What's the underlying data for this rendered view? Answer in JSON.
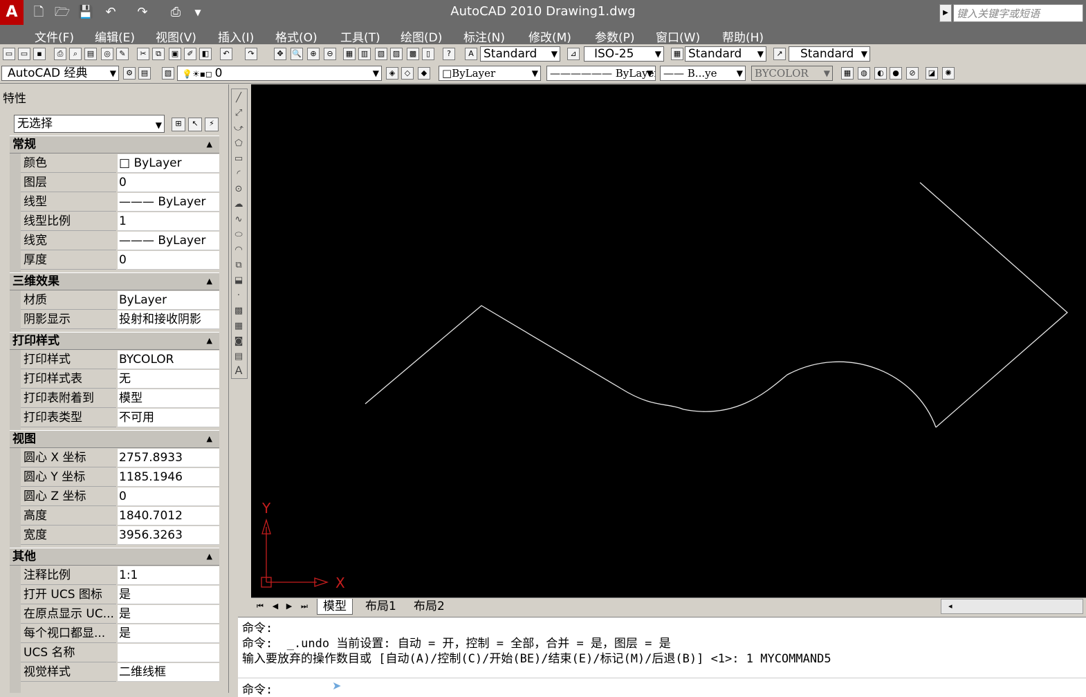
{
  "titlebar": {
    "title": "AutoCAD 2010    Drawing1.dwg",
    "logo_letter": "A",
    "quick_access": [
      "file-new-icon",
      "open-icon",
      "save-icon",
      "undo-icon",
      "redo-icon",
      "plot-icon",
      "dropdown-icon"
    ],
    "search_placeholder": "键入关键字或短语"
  },
  "menubar": {
    "items": [
      "文件(F)",
      "编辑(E)",
      "视图(V)",
      "插入(I)",
      "格式(O)",
      "工具(T)",
      "绘图(D)",
      "标注(N)",
      "修改(M)",
      "参数(P)",
      "窗口(W)",
      "帮助(H)"
    ]
  },
  "toolbar1": {
    "text_style": "Standard",
    "dim_style": "ISO-25",
    "table_style": "Standard",
    "mleader_style": "Standard"
  },
  "toolbar2": {
    "workspace": "AutoCAD 经典",
    "layer": "0",
    "color": "ByLayer",
    "linetype": "ByLayer",
    "lineweight": "B...ye",
    "plotstyle": "BYCOLOR"
  },
  "properties": {
    "title": "特性",
    "selection": "无选择",
    "sections": [
      {
        "name": "常规",
        "rows": [
          [
            "颜色",
            "□ ByLayer"
          ],
          [
            "图层",
            "0"
          ],
          [
            "线型",
            "——— ByLayer"
          ],
          [
            "线型比例",
            "1"
          ],
          [
            "线宽",
            "——— ByLayer"
          ],
          [
            "厚度",
            "0"
          ]
        ]
      },
      {
        "name": "三维效果",
        "rows": [
          [
            "材质",
            "ByLayer"
          ],
          [
            "阴影显示",
            "投射和接收阴影"
          ]
        ]
      },
      {
        "name": "打印样式",
        "rows": [
          [
            "打印样式",
            "BYCOLOR"
          ],
          [
            "打印样式表",
            "无"
          ],
          [
            "打印表附着到",
            "模型"
          ],
          [
            "打印表类型",
            "不可用"
          ]
        ]
      },
      {
        "name": "视图",
        "rows": [
          [
            "圆心 X 坐标",
            "2757.8933"
          ],
          [
            "圆心 Y 坐标",
            "1185.1946"
          ],
          [
            "圆心 Z 坐标",
            "0"
          ],
          [
            "高度",
            "1840.7012"
          ],
          [
            "宽度",
            "3956.3263"
          ]
        ]
      },
      {
        "name": "其他",
        "rows": [
          [
            "注释比例",
            "1:1"
          ],
          [
            "打开 UCS 图标",
            "是"
          ],
          [
            "在原点显示 UC...",
            "是"
          ],
          [
            "每个视口都显...",
            "是"
          ],
          [
            "UCS 名称",
            ""
          ],
          [
            "视觉样式",
            "二维线框"
          ]
        ]
      }
    ]
  },
  "canvas": {
    "ucs_y": "Y",
    "ucs_x": "X"
  },
  "tabs": {
    "items": [
      "模型",
      "布局1",
      "布局2"
    ],
    "active": 0
  },
  "command": {
    "lines": [
      "命令:",
      "命令:  _.undo 当前设置: 自动 = 开，控制 = 全部，合并 = 是，图层 = 是",
      "输入要放弃的操作数目或 [自动(A)/控制(C)/开始(BE)/结束(E)/标记(M)/后退(B)] <1>: 1 MYCOMMAND5"
    ],
    "prompt": "命令:"
  },
  "colors": {
    "canvas_bg": "#000000",
    "ucs_color": "#c81e1e",
    "title_bg": "#6b6b6b",
    "curve_color": "#ffffff"
  }
}
